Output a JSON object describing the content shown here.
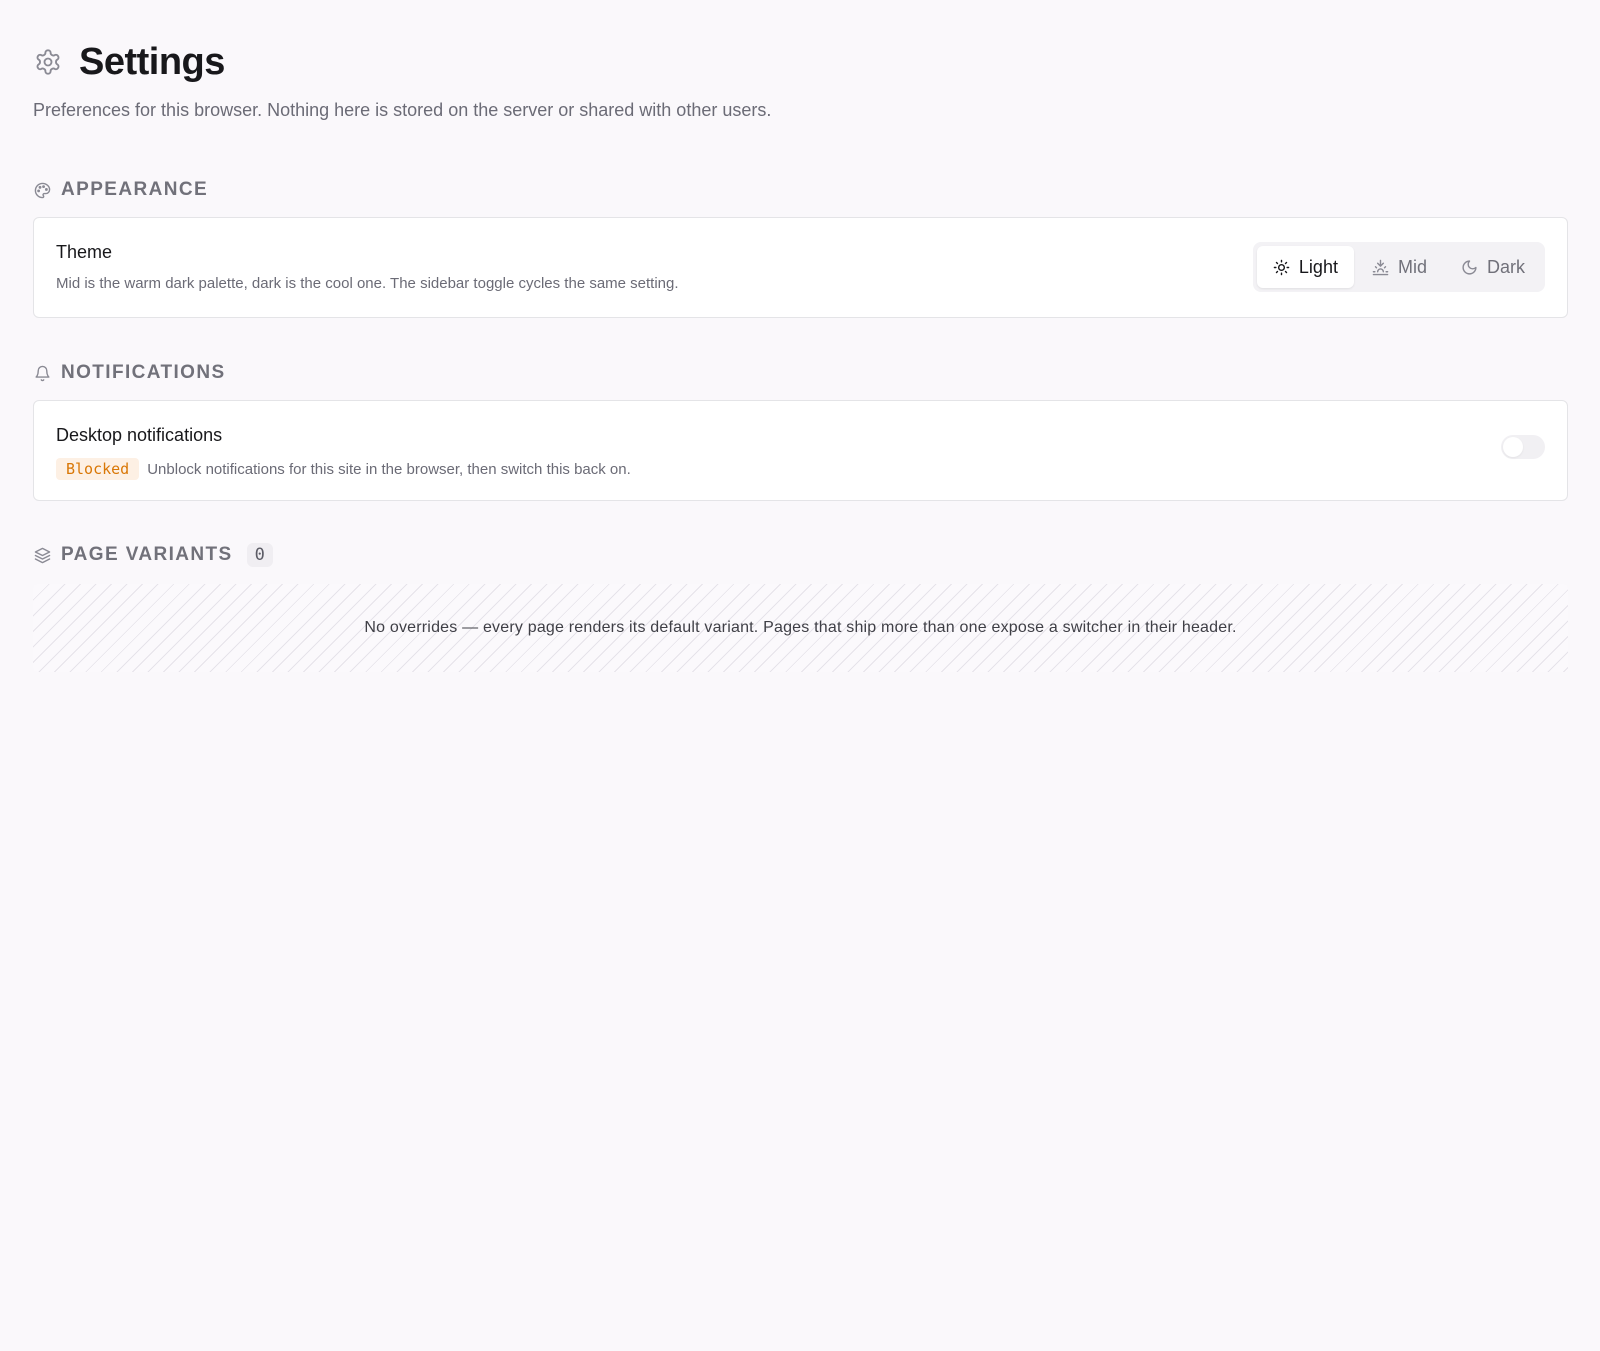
{
  "header": {
    "title": "Settings",
    "subtitle": "Preferences for this browser. Nothing here is stored on the server or shared with other users.",
    "icon": "gear-icon"
  },
  "appearance": {
    "label": "APPEARANCE",
    "icon": "palette-icon",
    "theme": {
      "title": "Theme",
      "description": "Mid is the warm dark palette, dark is the cool one. The sidebar toggle cycles the same setting.",
      "options": [
        {
          "label": "Light",
          "icon": "sun-icon",
          "selected": true
        },
        {
          "label": "Mid",
          "icon": "sunset-icon",
          "selected": false
        },
        {
          "label": "Dark",
          "icon": "moon-icon",
          "selected": false
        }
      ]
    }
  },
  "notifications": {
    "label": "NOTIFICATIONS",
    "icon": "bell-icon",
    "desktop": {
      "title": "Desktop notifications",
      "badge": "Blocked",
      "description": "Unblock notifications for this site in the browser, then switch this back on.",
      "enabled": false
    }
  },
  "page_variants": {
    "label": "PAGE VARIANTS",
    "icon": "layers-icon",
    "count": "0",
    "empty_message": "No overrides — every page renders its default variant. Pages that ship more than one expose a switcher in their header."
  },
  "colors": {
    "background": "#faf8fb",
    "card": "#ffffff",
    "border": "#e4e4e7",
    "muted_text": "#6b6b76",
    "blocked_text": "#d97706",
    "blocked_bg": "#fdf0e4"
  }
}
